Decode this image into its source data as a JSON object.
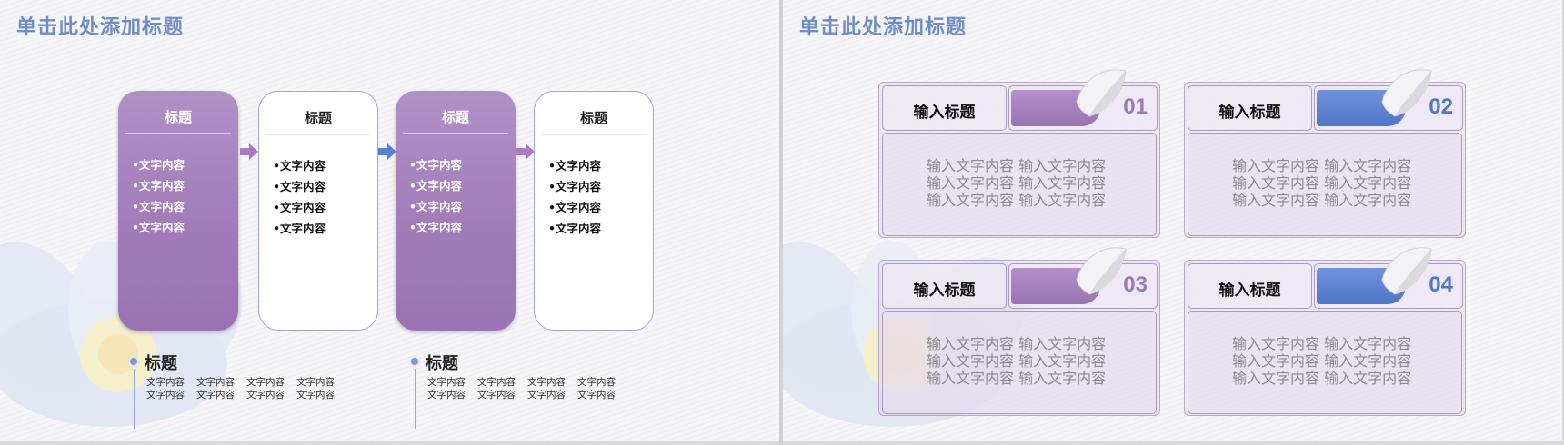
{
  "left": {
    "title": "单击此处添加标题",
    "cards": [
      {
        "title": "标题",
        "items": [
          "•文字内容",
          "•文字内容",
          "•文字内容",
          "•文字内容"
        ]
      },
      {
        "title": "标题",
        "items": [
          "•文字内容",
          "•文字内容",
          "•文字内容",
          "•文字内容"
        ]
      },
      {
        "title": "标题",
        "items": [
          "•文字内容",
          "•文字内容",
          "•文字内容",
          "•文字内容"
        ]
      },
      {
        "title": "标题",
        "items": [
          "•文字内容",
          "•文字内容",
          "•文字内容",
          "•文字内容"
        ]
      }
    ],
    "subsections": [
      {
        "title": "标题",
        "cells": [
          "文字内容",
          "文字内容",
          "文字内容",
          "文字内容",
          "文字内容",
          "文字内容",
          "文字内容",
          "文字内容"
        ]
      },
      {
        "title": "标题",
        "cells": [
          "文字内容",
          "文字内容",
          "文字内容",
          "文字内容",
          "文字内容",
          "文字内容",
          "文字内容",
          "文字内容"
        ]
      }
    ]
  },
  "right": {
    "title": "单击此处添加标题",
    "panels": [
      {
        "label": "输入标题",
        "number": "01",
        "lines": [
          "输入文字内容  输入文字内容",
          "输入文字内容  输入文字内容",
          "输入文字内容  输入文字内容"
        ]
      },
      {
        "label": "输入标题",
        "number": "02",
        "lines": [
          "输入文字内容  输入文字内容",
          "输入文字内容  输入文字内容",
          "输入文字内容  输入文字内容"
        ]
      },
      {
        "label": "输入标题",
        "number": "03",
        "lines": [
          "输入文字内容  输入文字内容",
          "输入文字内容  输入文字内容",
          "输入文字内容  输入文字内容"
        ]
      },
      {
        "label": "输入标题",
        "number": "04",
        "lines": [
          "输入文字内容  输入文字内容",
          "输入文字内容  输入文字内容",
          "输入文字内容  输入文字内容"
        ]
      }
    ]
  },
  "colors": {
    "title": "#6f8cc6",
    "purple": "#a07bb8",
    "blue": "#5a80cf",
    "number_purple": "#9a7ab5",
    "number_blue": "#4f76c8"
  }
}
